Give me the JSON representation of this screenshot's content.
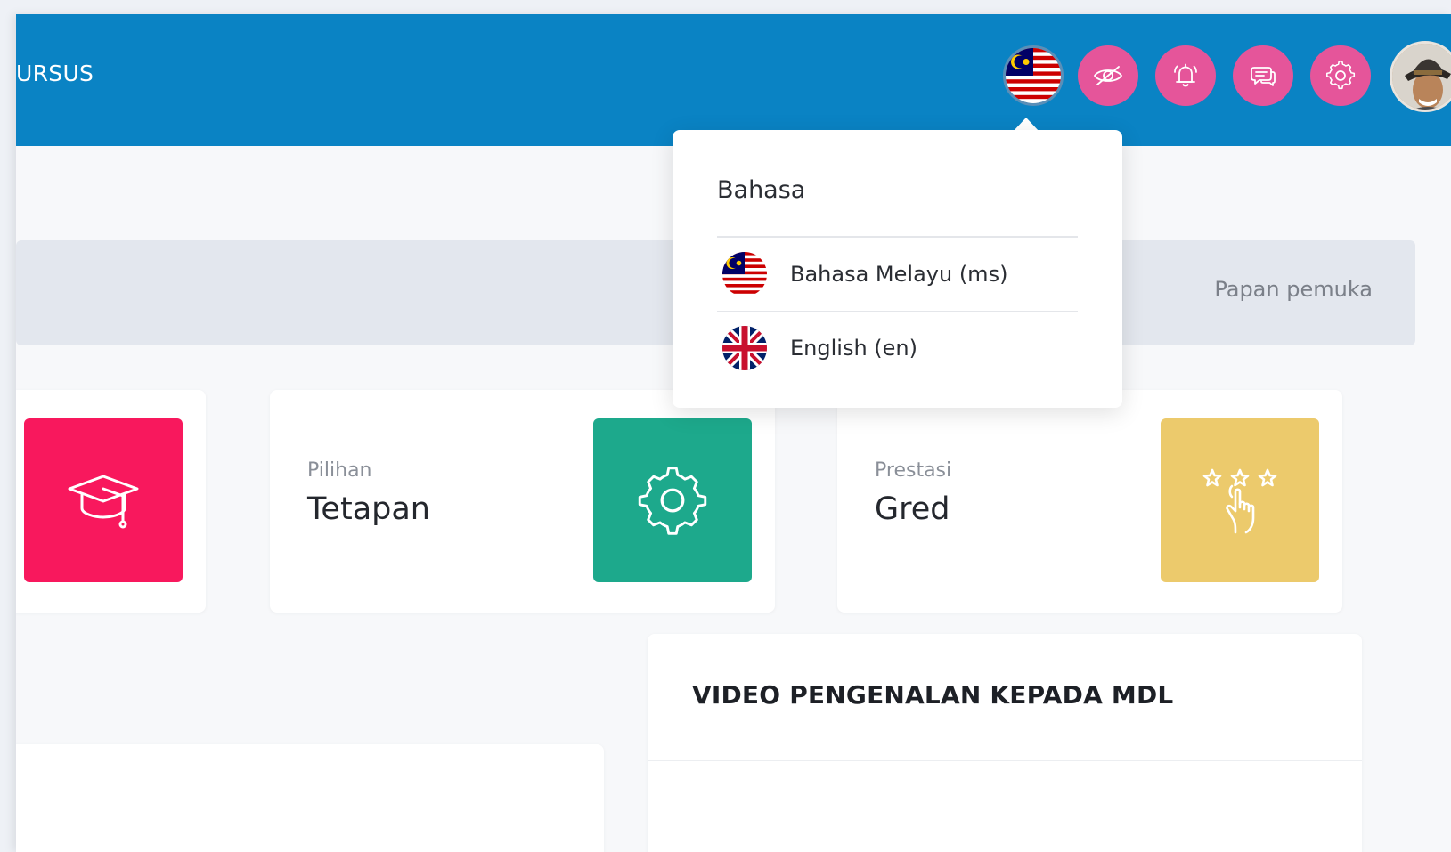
{
  "header": {
    "brand": "URSUS",
    "buttons": [
      {
        "name": "language",
        "icon": "malaysia-flag-icon"
      },
      {
        "name": "hide",
        "icon": "eye-slash-icon"
      },
      {
        "name": "notifications",
        "icon": "bell-icon"
      },
      {
        "name": "messages",
        "icon": "chat-bubbles-icon"
      },
      {
        "name": "settings",
        "icon": "gear-icon"
      },
      {
        "name": "profile",
        "icon": "avatar"
      }
    ],
    "colors": {
      "bar": "#0a83c4",
      "button": "#e5559a"
    }
  },
  "banner": {
    "link": "Papan pemuka"
  },
  "cards": [
    {
      "subtitle": "",
      "title": "",
      "icon": "graduation-cap-icon",
      "color": "#f8185d"
    },
    {
      "subtitle": "Pilihan",
      "title": "Tetapan",
      "icon": "gear-icon",
      "color": "#1da98c"
    },
    {
      "subtitle": "Prestasi",
      "title": "Gred",
      "icon": "stars-hand-icon",
      "color": "#ecca6c"
    }
  ],
  "panels": {
    "video": {
      "title": "VIDEO PENGENALAN KEPADA MDL"
    }
  },
  "language_menu": {
    "title": "Bahasa",
    "options": [
      {
        "label": "Bahasa Melayu (ms)",
        "flag": "malaysia-flag-icon"
      },
      {
        "label": "English (en)",
        "flag": "uk-flag-icon"
      }
    ]
  }
}
